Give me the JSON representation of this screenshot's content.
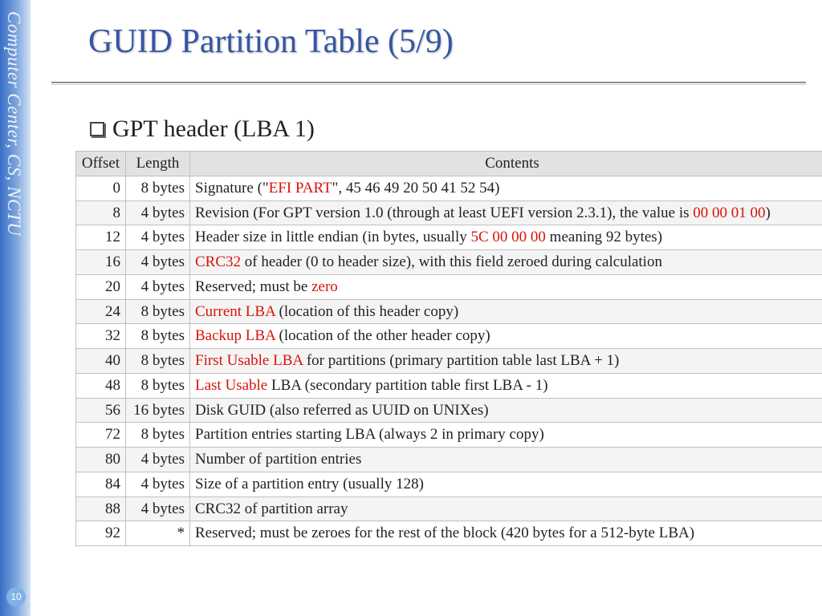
{
  "sidebar": {
    "label": "Computer Center, CS, NCTU"
  },
  "page_number": "10",
  "title": "GUID Partition Table (5/9)",
  "bullet": "GPT header (LBA 1)",
  "headers": {
    "offset": "Offset",
    "length": "Length",
    "contents": "Contents"
  },
  "rows": [
    {
      "offset": "0",
      "length": "8 bytes",
      "segments": [
        {
          "t": "Signature (\""
        },
        {
          "t": "EFI PART",
          "red": true
        },
        {
          "t": "\", 45 46 49 20 50 41 52 54)"
        }
      ]
    },
    {
      "offset": "8",
      "length": "4 bytes",
      "segments": [
        {
          "t": "Revision (For GPT version 1.0 (through at least UEFI version 2.3.1), the value is "
        },
        {
          "t": "00 00 01 00",
          "red": true
        },
        {
          "t": ")"
        }
      ]
    },
    {
      "offset": "12",
      "length": "4 bytes",
      "segments": [
        {
          "t": "Header size in little endian (in bytes, usually "
        },
        {
          "t": "5C 00 00 00",
          "red": true
        },
        {
          "t": " meaning 92 bytes)"
        }
      ]
    },
    {
      "offset": "16",
      "length": "4 bytes",
      "segments": [
        {
          "t": "CRC32",
          "red": true
        },
        {
          "t": " of header (0 to header size), with this field zeroed during calculation"
        }
      ]
    },
    {
      "offset": "20",
      "length": "4 bytes",
      "segments": [
        {
          "t": "Reserved; must be "
        },
        {
          "t": "zero",
          "red": true
        }
      ]
    },
    {
      "offset": "24",
      "length": "8 bytes",
      "segments": [
        {
          "t": "Current LBA ",
          "red": true
        },
        {
          "t": "(location of this header copy)"
        }
      ]
    },
    {
      "offset": "32",
      "length": "8 bytes",
      "segments": [
        {
          "t": "Backup LBA ",
          "red": true
        },
        {
          "t": "(location of the other header copy)"
        }
      ]
    },
    {
      "offset": "40",
      "length": "8 bytes",
      "segments": [
        {
          "t": "First Usable LBA ",
          "red": true
        },
        {
          "t": "for partitions (primary partition table last LBA + 1)"
        }
      ]
    },
    {
      "offset": "48",
      "length": "8 bytes",
      "segments": [
        {
          "t": "Last Usable ",
          "red": true
        },
        {
          "t": "LBA (secondary partition table first LBA - 1)"
        }
      ]
    },
    {
      "offset": "56",
      "length": "16 bytes",
      "segments": [
        {
          "t": "Disk GUID (also referred as UUID on UNIXes)"
        }
      ]
    },
    {
      "offset": "72",
      "length": "8 bytes",
      "segments": [
        {
          "t": "Partition entries starting LBA (always 2 in primary copy)"
        }
      ]
    },
    {
      "offset": "80",
      "length": "4 bytes",
      "segments": [
        {
          "t": "Number of partition entries"
        }
      ]
    },
    {
      "offset": "84",
      "length": "4 bytes",
      "segments": [
        {
          "t": "Size of a partition entry (usually 128)"
        }
      ]
    },
    {
      "offset": "88",
      "length": "4 bytes",
      "segments": [
        {
          "t": "CRC32 of partition array"
        }
      ]
    },
    {
      "offset": "92",
      "length": "*",
      "segments": [
        {
          "t": "Reserved; must be zeroes for the rest of the block (420 bytes for a 512-byte LBA)"
        }
      ]
    }
  ]
}
